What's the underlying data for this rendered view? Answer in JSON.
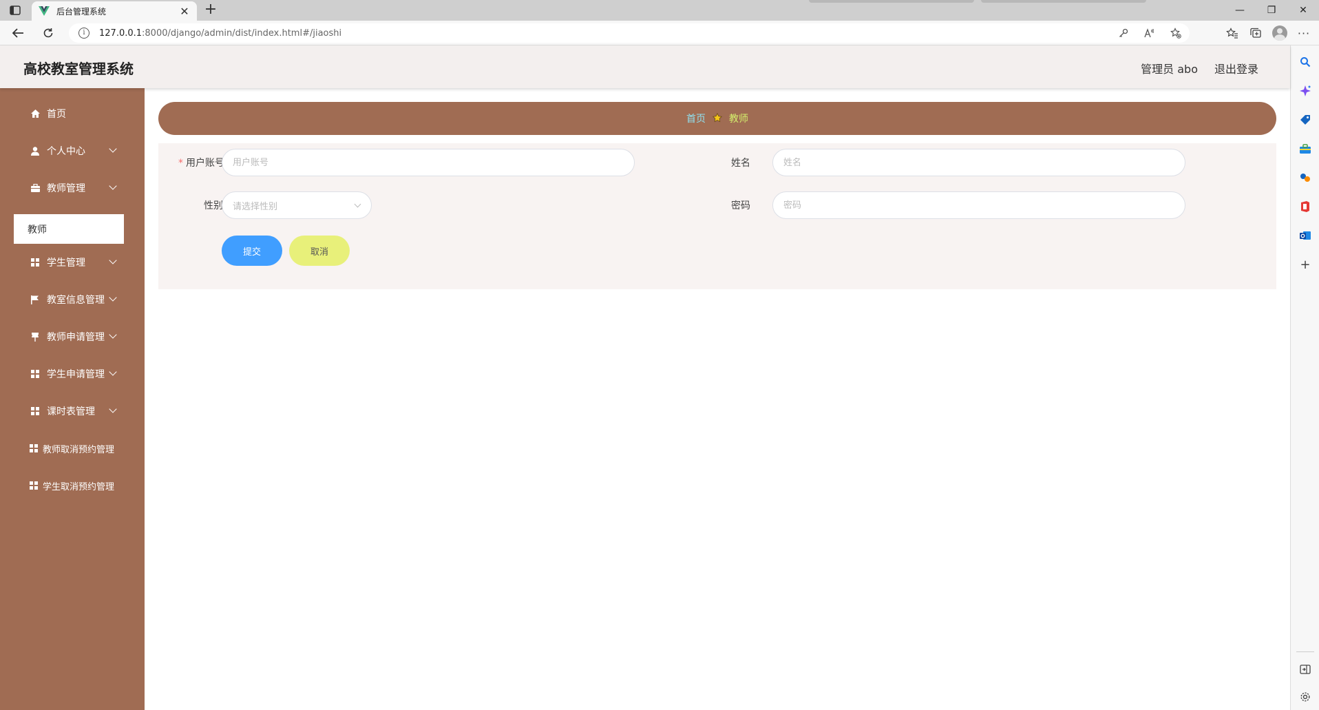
{
  "browser": {
    "tab_title": "后台管理系统",
    "tab_close": "✕",
    "new_tab": "+",
    "url_host": "127.0.0.1",
    "url_rest": ":8000/django/admin/dist/index.html#/jiaoshi",
    "window": {
      "minimize": "—",
      "restore": "❐",
      "close": "✕"
    }
  },
  "header": {
    "title": "高校教室管理系统",
    "user": "管理员 abo",
    "logout": "退出登录"
  },
  "sidebar": {
    "items": [
      {
        "label": "首页",
        "icon": "home-icon",
        "has_children": false
      },
      {
        "label": "个人中心",
        "icon": "user-icon",
        "has_children": true
      },
      {
        "label": "教师管理",
        "icon": "briefcase-icon",
        "has_children": true
      },
      {
        "label": "学生管理",
        "icon": "grid-icon",
        "has_children": true
      },
      {
        "label": "教室信息管理",
        "icon": "flag-icon",
        "has_children": true
      },
      {
        "label": "教师申请管理",
        "icon": "pin-icon",
        "has_children": true
      },
      {
        "label": "学生申请管理",
        "icon": "grid-icon",
        "has_children": true
      },
      {
        "label": "课时表管理",
        "icon": "grid-icon",
        "has_children": true
      },
      {
        "label": "教师取消预约管理",
        "icon": "grid-icon",
        "has_children": false
      },
      {
        "label": "学生取消预约管理",
        "icon": "grid-icon",
        "has_children": false
      }
    ],
    "submenu_active": "教师"
  },
  "breadcrumb": {
    "home": "首页",
    "current": "教师"
  },
  "form": {
    "account": {
      "label": "用户账号",
      "required_mark": "*",
      "value": "",
      "placeholder": "用户账号"
    },
    "name": {
      "label": "姓名",
      "value": "",
      "placeholder": "姓名"
    },
    "gender": {
      "label": "性别",
      "placeholder": "请选择性别"
    },
    "password": {
      "label": "密码",
      "value": "",
      "placeholder": "密码"
    },
    "submit": "提交",
    "cancel": "取消"
  },
  "colors": {
    "sidebar_bg": "#a06c53",
    "header_bg": "#f3efee",
    "submit_bg": "#409eff",
    "cancel_bg": "#e8f07a",
    "breadcrumb_home": "#90e0ef",
    "breadcrumb_current": "#d4f06d"
  }
}
